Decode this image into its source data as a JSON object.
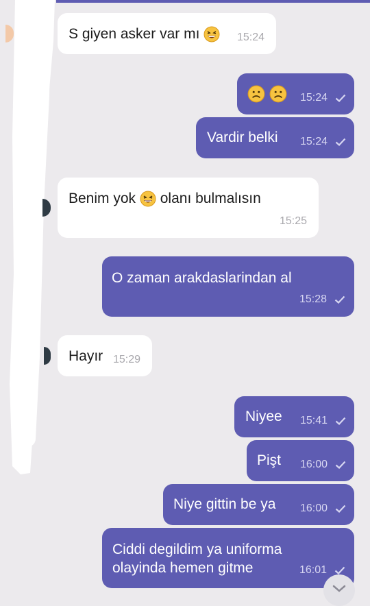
{
  "colors": {
    "outgoing_bubble": "#5e5cb2",
    "incoming_bubble": "#ffffff",
    "background": "#eceaed",
    "accent_bar": "#5e5cb2"
  },
  "messages": [
    {
      "direction": "incoming",
      "text_before": "S giyen asker var mı",
      "emoji": "grinning-squinting-face",
      "text_after": "",
      "time": "15:24"
    },
    {
      "direction": "outgoing",
      "text_before": "",
      "emoji": "frowning-face x2",
      "text_after": "",
      "time": "15:24",
      "status": "sent-check"
    },
    {
      "direction": "outgoing",
      "text_before": "Vardir belki",
      "time": "15:24",
      "status": "sent-check"
    },
    {
      "direction": "incoming",
      "text_before": "Benim yok",
      "emoji": "grinning-squinting-face",
      "text_after": "olanı bulmalısın",
      "time": "15:25"
    },
    {
      "direction": "outgoing",
      "text_before": "O zaman arakdaslarindan al",
      "time": "15:28",
      "status": "sent-check"
    },
    {
      "direction": "incoming",
      "text_before": "Hayır",
      "time": "15:29"
    },
    {
      "direction": "outgoing",
      "text_before": "Niyee",
      "time": "15:41",
      "status": "sent-check"
    },
    {
      "direction": "outgoing",
      "text_before": "Pişt",
      "time": "16:00",
      "status": "sent-check"
    },
    {
      "direction": "outgoing",
      "text_before": "Niye gittin be ya",
      "time": "16:00",
      "status": "sent-check"
    },
    {
      "direction": "outgoing",
      "line1": "Ciddi degildim ya uniforma",
      "line2": "olayinda hemen gitme",
      "time": "16:01",
      "status": "sent-check"
    }
  ],
  "icons": {
    "check": "check-icon",
    "scroll_down": "chevron-down-icon"
  }
}
